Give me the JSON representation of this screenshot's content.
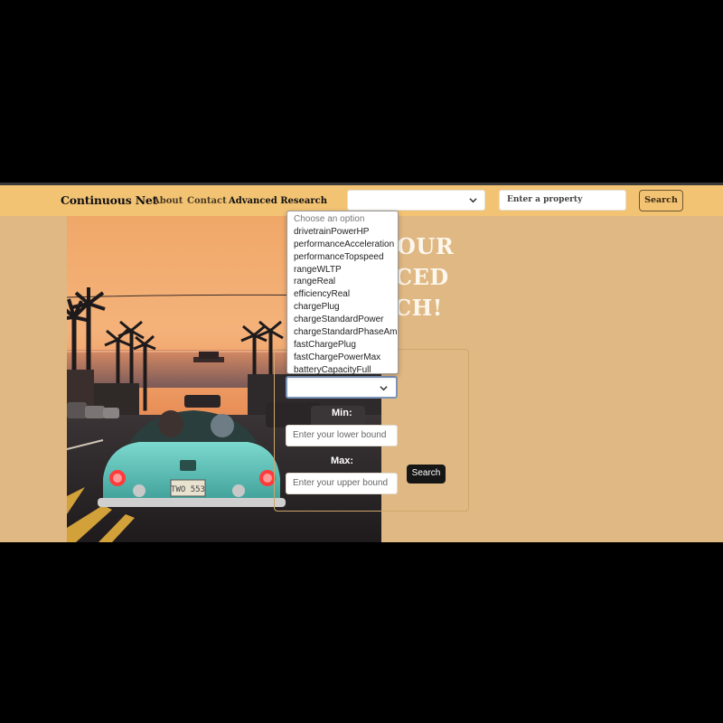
{
  "navbar": {
    "brand": "Continuous Net",
    "links": [
      "About",
      "Contact",
      "Advanced Research"
    ],
    "select_value": "",
    "property_placeholder": "Enter a property",
    "search_label": "Search"
  },
  "hero": {
    "headline_lines": [
      "OUR",
      "CED",
      "CH!"
    ]
  },
  "dropdown": {
    "options": [
      "Choose an option",
      "drivetrainPowerHP",
      "performanceAcceleration",
      "performanceTopspeed",
      "rangeWLTP",
      "rangeReal",
      "efficiencyReal",
      "chargePlug",
      "chargeStandardPower",
      "chargeStandardPhaseAmp",
      "fastChargePlug",
      "fastChargePowerMax",
      "batteryCapacityFull"
    ]
  },
  "form": {
    "min_label": "Min:",
    "max_label": "Max:",
    "lower_placeholder": "Enter your lower bound",
    "upper_placeholder": "Enter your upper bound",
    "search_label": "Search"
  },
  "license_plate": "TWO 553",
  "colors": {
    "navbar": "#f3c374",
    "page_background": "#e0b883",
    "headline": "#fdf7ee",
    "button_dark": "#161616"
  }
}
